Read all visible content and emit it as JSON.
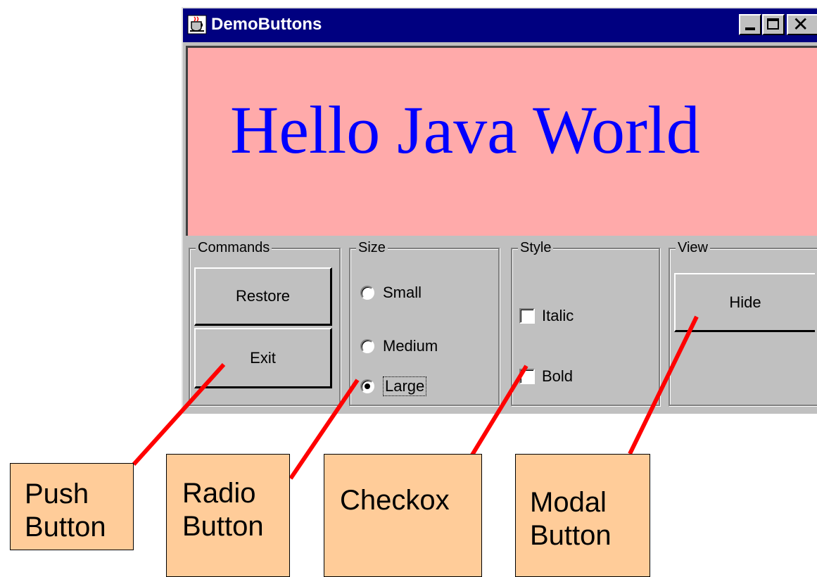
{
  "window": {
    "title": "DemoButtons",
    "controls": {
      "minimize": "minimize-icon",
      "maximize": "maximize-icon",
      "close": "close-icon"
    }
  },
  "canvas": {
    "text": "Hello Java World",
    "background": "#ffaaaa",
    "text_color": "#0000ff"
  },
  "groups": {
    "commands": {
      "label": "Commands",
      "buttons": [
        "Restore",
        "Exit"
      ]
    },
    "size": {
      "label": "Size",
      "options": [
        {
          "label": "Small",
          "selected": false
        },
        {
          "label": "Medium",
          "selected": false
        },
        {
          "label": "Large",
          "selected": true
        }
      ]
    },
    "style": {
      "label": "Style",
      "options": [
        {
          "label": "Italic",
          "checked": false
        },
        {
          "label": "Bold",
          "checked": false
        }
      ]
    },
    "view": {
      "label": "View",
      "button": "Hide"
    }
  },
  "callouts": {
    "push": [
      "Push",
      "Button"
    ],
    "radio": [
      "Radio",
      "Button"
    ],
    "checkbox": [
      "Checkox"
    ],
    "modal": [
      "Modal",
      "Button"
    ],
    "box_color": "#ffcc99",
    "line_color": "#ff0000"
  }
}
